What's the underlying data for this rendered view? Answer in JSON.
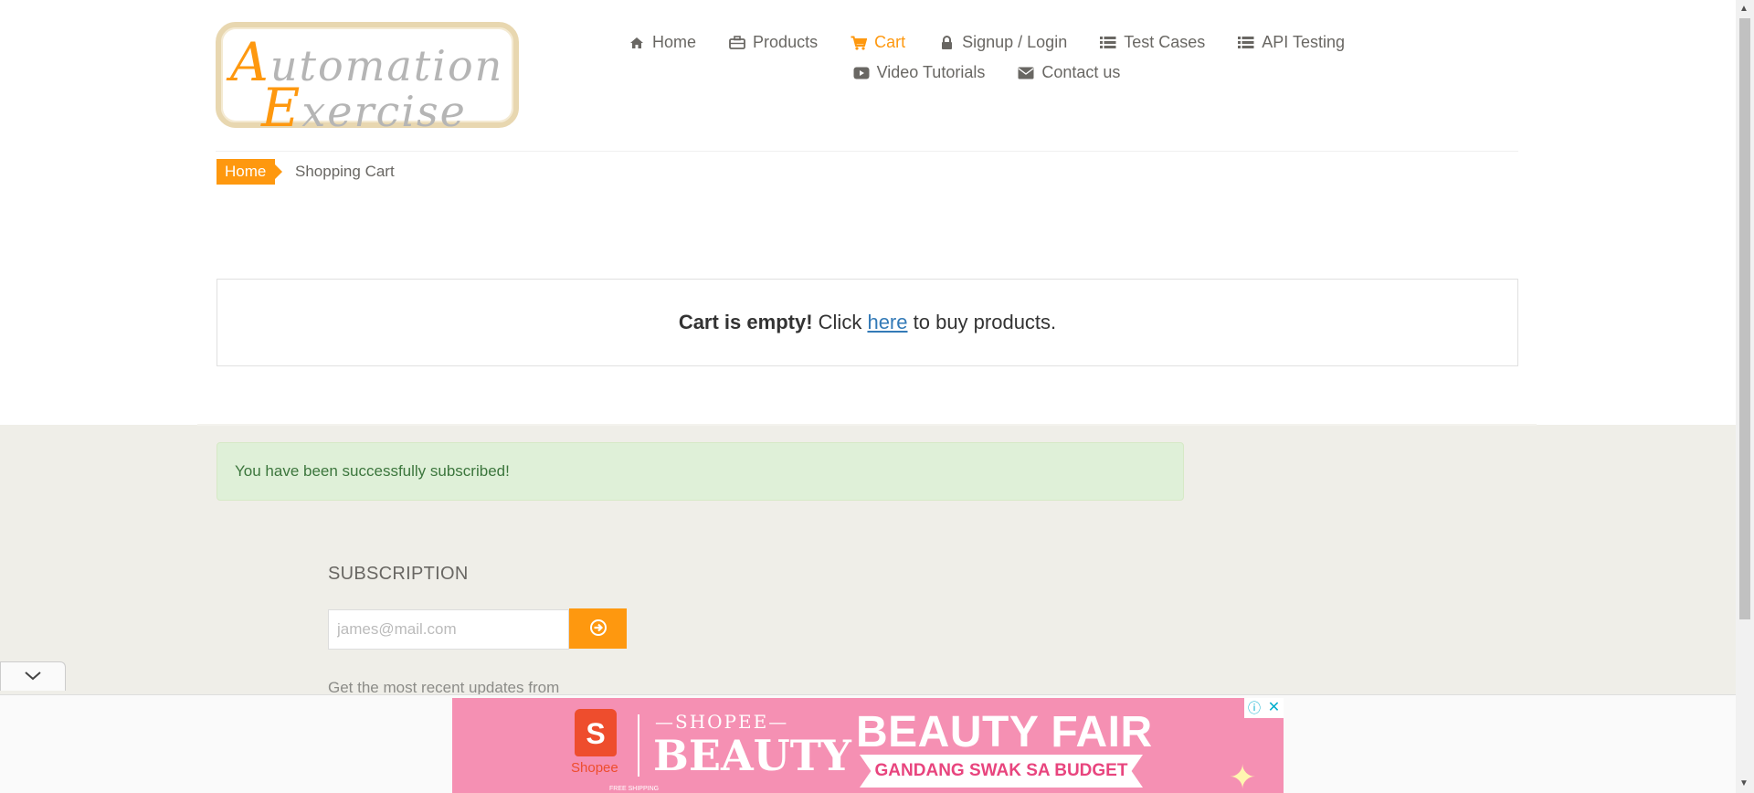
{
  "logo": {
    "line1_cap": "A",
    "line1_rest": "utomation",
    "line2_cap": "E",
    "line2_rest": "xercise"
  },
  "nav": {
    "items": [
      {
        "label": "Home",
        "icon": "home-icon"
      },
      {
        "label": "Products",
        "icon": "briefcase-icon"
      },
      {
        "label": "Cart",
        "icon": "shopping-cart-icon",
        "active": true
      },
      {
        "label": "Signup / Login",
        "icon": "lock-icon"
      },
      {
        "label": "Test Cases",
        "icon": "list-icon"
      },
      {
        "label": "API Testing",
        "icon": "list-icon"
      },
      {
        "label": "Video Tutorials",
        "icon": "youtube-play-icon"
      },
      {
        "label": "Contact us",
        "icon": "envelope-icon"
      }
    ]
  },
  "breadcrumb": {
    "home": "Home",
    "current": "Shopping Cart"
  },
  "cart": {
    "empty_bold": "Cart is empty!",
    "click": "Click",
    "link": "here",
    "rest": "to buy products."
  },
  "alert": {
    "message": "You have been successfully subscribed!"
  },
  "subscription": {
    "title": "SUBSCRIPTION",
    "placeholder": "james@mail.com",
    "description": "Get the most recent updates from"
  },
  "ad": {
    "logo_letter": "S",
    "logo_label": "Shopee",
    "brand_top": "—SHOPEE—",
    "brand": "BEAUTY",
    "title": "BEAUTY FAIR",
    "ribbon": "GANDANG SWAK SA BUDGET",
    "fine_print": "FREE SHIPPING"
  },
  "colors": {
    "accent": "#fe980f",
    "text": "#696763",
    "footer_bg": "#efeee8",
    "alert_bg": "#dff0d8",
    "alert_text": "#3c763d",
    "link": "#337ab7",
    "ad_pink": "#f590b3"
  }
}
